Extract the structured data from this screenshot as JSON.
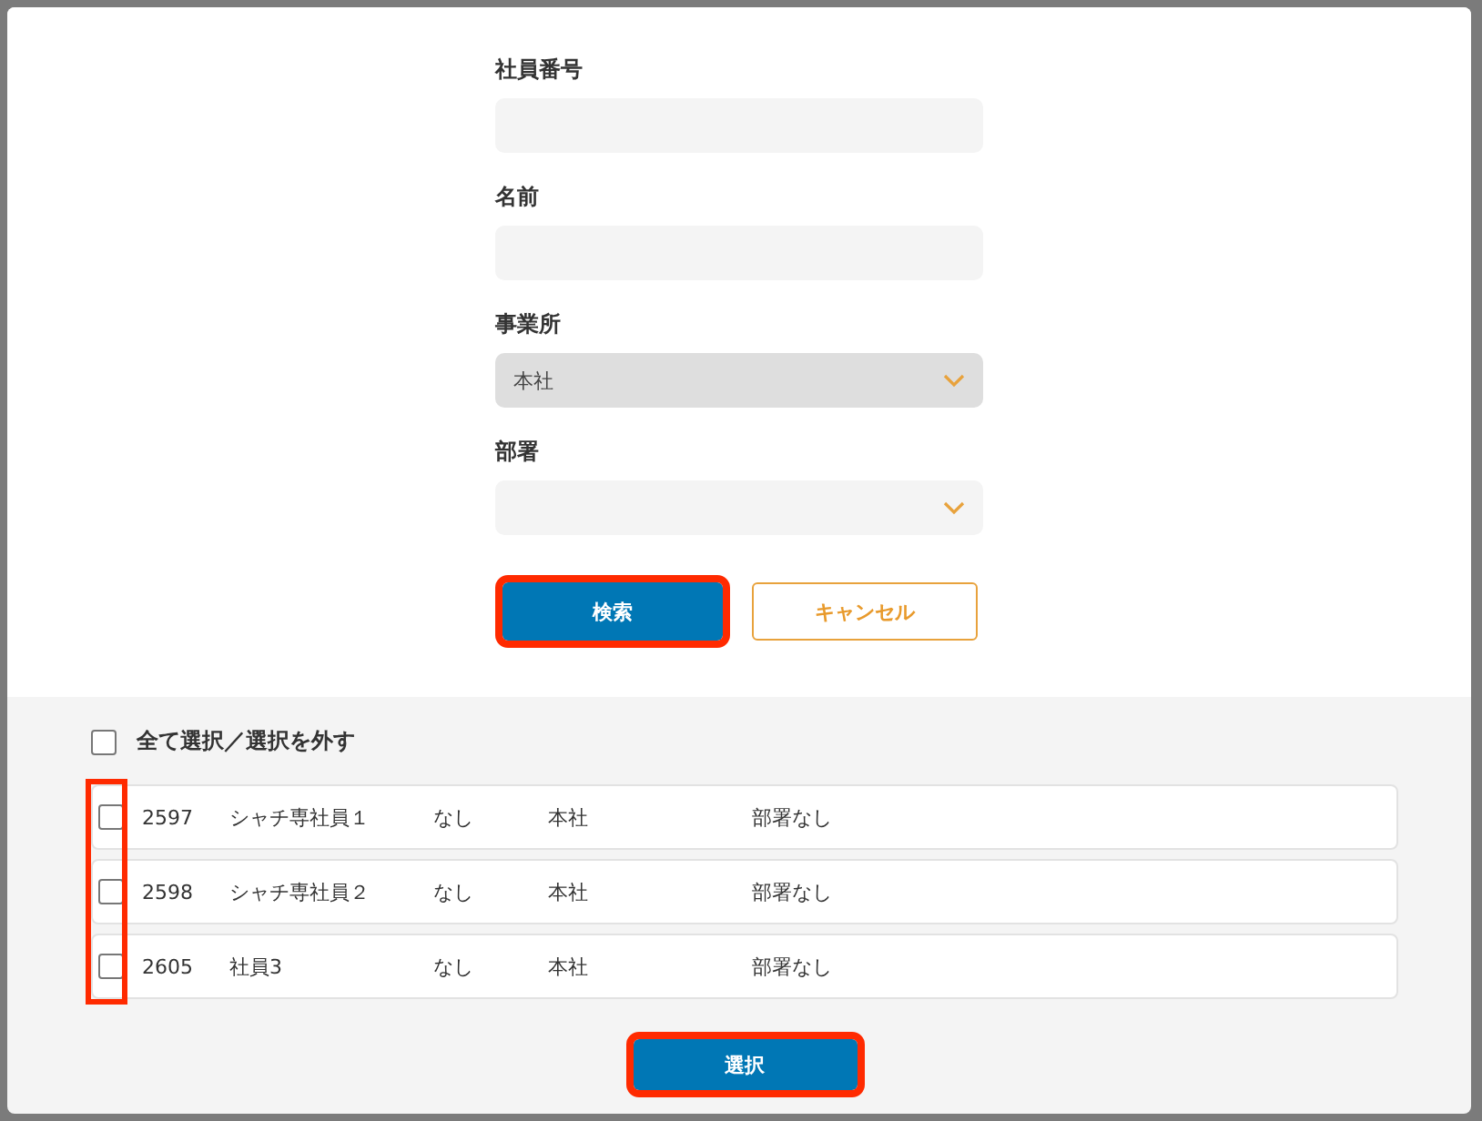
{
  "fields": [
    {
      "kind": "text",
      "label": "社員番号"
    },
    {
      "kind": "text",
      "label": "名前"
    },
    {
      "kind": "select",
      "label": "事業所",
      "value": "本社",
      "disabled": true
    },
    {
      "kind": "select",
      "label": "部署",
      "disabled": false
    }
  ],
  "buttons": [
    {
      "kind": "primary",
      "label": "検索",
      "highlighted": true
    },
    {
      "kind": "secondary",
      "label": "キャンセル",
      "highlighted": false
    }
  ],
  "select_all": {
    "label": "全て選択／選択を外す",
    "checked": false
  },
  "results": {
    "checkboxes_highlighted": true,
    "rows": [
      {
        "checked": false,
        "cells": [
          "2597",
          "シャチ専社員１",
          "なし",
          "本社",
          "部署なし"
        ]
      },
      {
        "checked": false,
        "cells": [
          "2598",
          "シャチ専社員２",
          "なし",
          "本社",
          "部署なし"
        ]
      },
      {
        "checked": false,
        "cells": [
          "2605",
          "社員3",
          "なし",
          "本社",
          "部署なし"
        ]
      }
    ]
  },
  "submit_button": {
    "label": "選択",
    "highlighted": true
  }
}
